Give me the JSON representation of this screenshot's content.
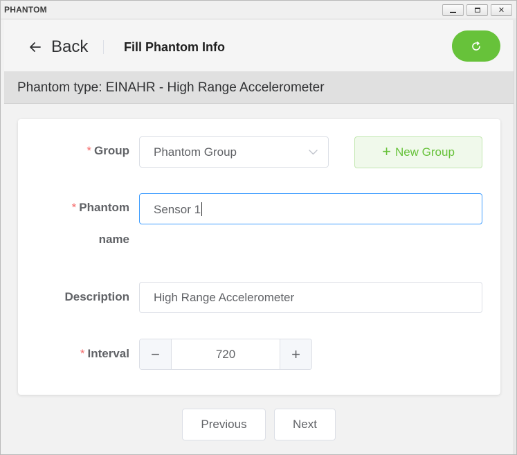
{
  "window": {
    "title": "PHANTOM",
    "minimize_icon": "minimize-icon",
    "maximize_icon": "maximize-icon",
    "close_icon": "close-icon",
    "close_glyph": "✕"
  },
  "header": {
    "back_label": "Back",
    "page_title": "Fill Phantom Info",
    "refresh_icon": "refresh-icon",
    "accent": "#67c23a"
  },
  "phantom_type": "Phantom type: EINAHR - High Range Accelerometer",
  "form": {
    "group": {
      "required_mark": "*",
      "label": "Group",
      "selected": "Phantom Group",
      "new_group_plus": "+",
      "new_group_label": "New Group"
    },
    "phantom_name": {
      "required_mark": "*",
      "label_line1": "Phantom",
      "label_line2": "name",
      "value": "Sensor 1"
    },
    "description": {
      "label": "Description",
      "value": "High Range Accelerometer"
    },
    "interval": {
      "required_mark": "*",
      "label": "Interval",
      "decrement": "−",
      "value": "720",
      "increment": "+"
    }
  },
  "footer": {
    "previous_label": "Previous",
    "next_label": "Next"
  }
}
